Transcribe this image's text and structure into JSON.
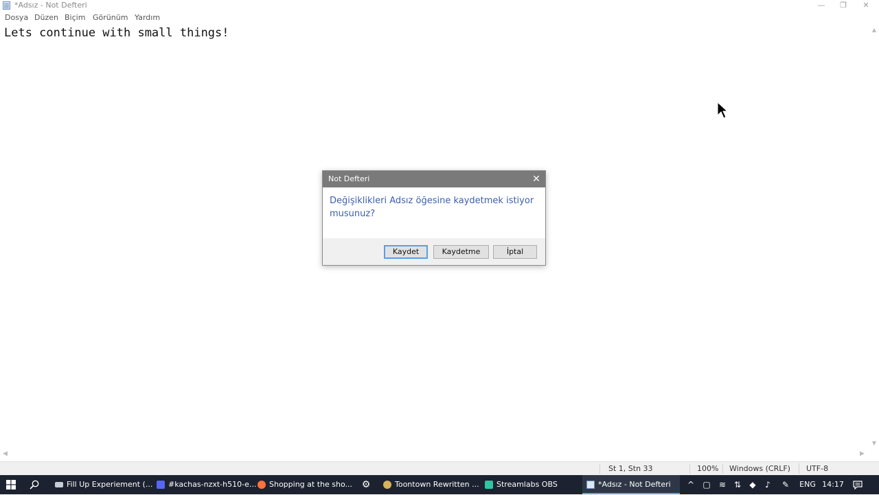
{
  "window": {
    "title": "*Adsız - Not Defteri",
    "minimize": "—",
    "restore": "❐",
    "close": "✕"
  },
  "menu": [
    "Dosya",
    "Düzen",
    "Biçim",
    "Görünüm",
    "Yardım"
  ],
  "editor": {
    "text": "Lets continue with small things!"
  },
  "status": {
    "position": "St 1, Stn 33",
    "zoom": "100%",
    "line_ending": "Windows (CRLF)",
    "encoding": "UTF-8"
  },
  "dialog": {
    "title": "Not Defteri",
    "message": "Değişiklikleri Adsız öğesine kaydetmek istiyor musunuz?",
    "buttons": {
      "save": "Kaydet",
      "dont_save": "Kaydetme",
      "cancel": "İptal"
    }
  },
  "taskbar": {
    "items": [
      "Fill Up Experiement (...",
      "#kachas-nzxt-h510-e...",
      "Shopping at the sho...",
      "Toontown Rewritten ...",
      "Streamlabs OBS",
      "*Adsız - Not Defteri"
    ],
    "language": "ENG",
    "clock": "14:17"
  },
  "colors": {
    "accent": "#5a9ee6",
    "dialog_title_bg": "#7a7a7a",
    "dialog_message": "#3c5fb0",
    "taskbar_bg": "#1c2230"
  }
}
